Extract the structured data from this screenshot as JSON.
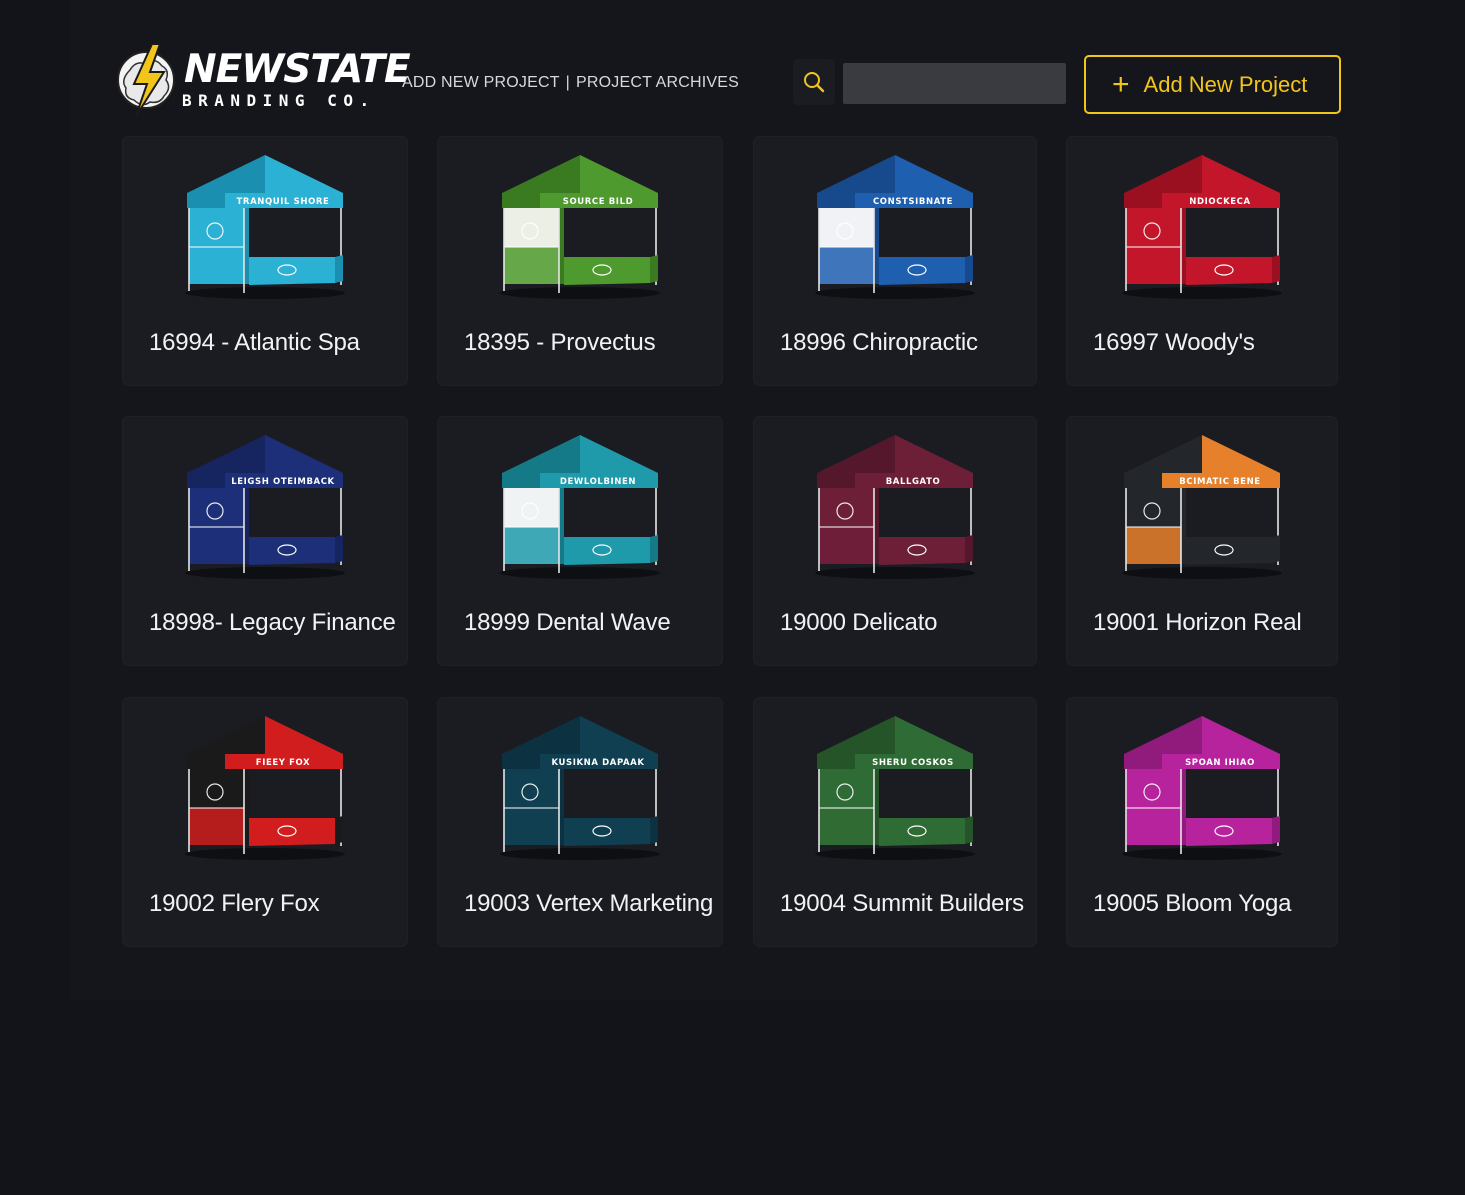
{
  "header": {
    "logo": {
      "wordmark": "NEWSTATE",
      "subtitle": "BRANDING CO.",
      "icon": "lightning-bolt-icon",
      "accent": "#f2c51b"
    },
    "nav": {
      "add_project": "ADD NEW PROJECT",
      "separator": "|",
      "archives": "PROJECT ARCHIVES"
    },
    "search": {
      "icon": "search-icon",
      "value": "",
      "placeholder": ""
    },
    "add_button": {
      "icon": "plus-icon",
      "label": "Add New Project"
    }
  },
  "projects": [
    {
      "label": "16994 - Atlantic Spa",
      "canopy_text": "TRANQUIL SHORE",
      "color": "#2bb1d3",
      "dark": "#1a8fb0",
      "panel": "#2bb1d3",
      "skirt": "#2bb1d3"
    },
    {
      "label": "18395 - Provectus",
      "canopy_text": "SOURCE BILD",
      "color": "#4f9a2e",
      "dark": "#3a7a20",
      "panel": "#ecefe6",
      "skirt": "#4f9a2e"
    },
    {
      "label": "18996  Chiropractic",
      "canopy_text": "CONSTSIBNATE",
      "color": "#1f5fb0",
      "dark": "#174a8c",
      "panel": "#f0f2f6",
      "skirt": "#1f5fb0"
    },
    {
      "label": "16997  Woody's",
      "canopy_text": "NDIOCKECA",
      "color": "#c4162a",
      "dark": "#9a1020",
      "panel": "#c4162a",
      "skirt": "#c4162a"
    },
    {
      "label": "18998- Legacy Finance",
      "canopy_text": "LEIGSH OTEIMBACK",
      "color": "#1d2f78",
      "dark": "#162460",
      "panel": "#1d2f78",
      "skirt": "#1d2f78"
    },
    {
      "label": "18999   Dental Wave",
      "canopy_text": "DEWLOLBINEN",
      "color": "#1e9aaa",
      "dark": "#157a88",
      "panel": "#eff3f3",
      "skirt": "#1e9aaa"
    },
    {
      "label": "19000   Delicato",
      "canopy_text": "BALLGATO",
      "color": "#6e1f38",
      "dark": "#55172b",
      "panel": "#6e1f38",
      "skirt": "#6e1f38"
    },
    {
      "label": "19001   Horizon Real",
      "canopy_text": "BCIMATIC BENE",
      "color": "#e7802a",
      "dark": "#23262b",
      "panel": "#23262b",
      "skirt": "#23262b"
    },
    {
      "label": "19002   Flery Fox",
      "canopy_text": "FIEEY FOX",
      "color": "#d11d1d",
      "dark": "#1a1a1a",
      "panel": "#1a1a1a",
      "skirt": "#d11d1d"
    },
    {
      "label": "19003   Vertex Marketing",
      "canopy_text": "KUSIKNA DAPAAK",
      "color": "#103f52",
      "dark": "#0c3242",
      "panel": "#103f52",
      "skirt": "#103f52"
    },
    {
      "label": "19004   Summit Builders",
      "canopy_text": "SHERU COSKOS",
      "color": "#2f6b34",
      "dark": "#245428",
      "panel": "#2f6b34",
      "skirt": "#2f6b34"
    },
    {
      "label": "19005   Bloom Yoga",
      "canopy_text": "SPOAN IHIAO",
      "color": "#b7239c",
      "dark": "#911b7c",
      "panel": "#b7239c",
      "skirt": "#b7239c"
    }
  ]
}
